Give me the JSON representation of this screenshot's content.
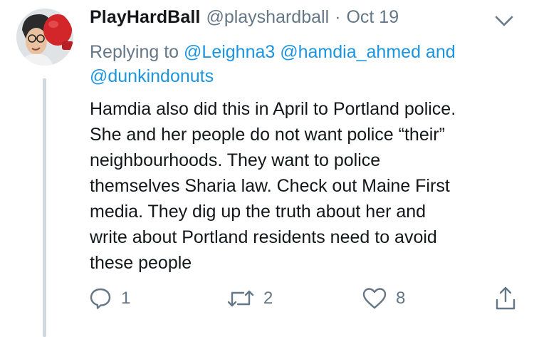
{
  "tweet": {
    "display_name": "PlayHardBall",
    "handle": "@playshardball",
    "separator": "·",
    "date": "Oct 19",
    "replying_prefix": "Replying to",
    "mentions": [
      "@Leighna3",
      "@hamdia_ahmed",
      "@dunkindonuts"
    ],
    "mention_joiner": "and",
    "text_lines": [
      "Hamdia also did this in April to Portland police.",
      "She and her people do not want police “their”",
      "neighbourhoods. They want to police",
      "themselves Sharia law. Check out Maine First",
      "media. They dig up the truth about her and",
      "write about Portland residents need to avoid",
      "these people"
    ]
  },
  "actions": {
    "reply_count": "1",
    "retweet_count": "2",
    "like_count": "8"
  },
  "icons": {
    "avatar": "avatar-boxing-glove",
    "menu": "chevron-down-icon",
    "reply": "reply-icon",
    "retweet": "retweet-icon",
    "like": "heart-icon",
    "share": "share-icon"
  },
  "colors": {
    "text": "#14171a",
    "secondary": "#657786",
    "link": "#1b95e0",
    "thread_line": "#cfd8df",
    "glove_red": "#d3262b"
  }
}
